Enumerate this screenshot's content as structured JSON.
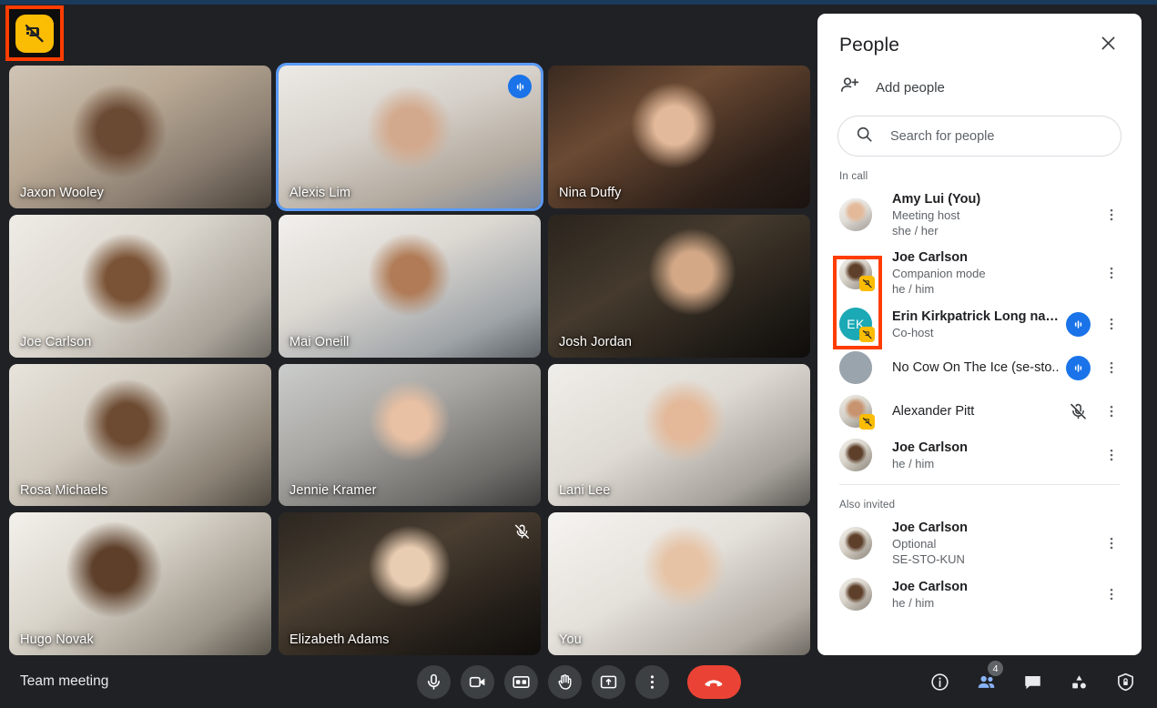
{
  "companion_toggle": {
    "name": "companion-mode-off-button",
    "icon": "screen-share-off-icon",
    "color": "#fbbc04",
    "highlight_color": "#ff3d00"
  },
  "grid": {
    "tiles": [
      {
        "name": "Jaxon Wooley",
        "speaking": false,
        "muted": false,
        "style": "p1"
      },
      {
        "name": "Alexis Lim",
        "speaking": true,
        "muted": false,
        "style": "p2"
      },
      {
        "name": "Nina Duffy",
        "speaking": false,
        "muted": false,
        "style": "p3"
      },
      {
        "name": "Joe Carlson",
        "speaking": false,
        "muted": false,
        "style": "p4"
      },
      {
        "name": "Mai Oneill",
        "speaking": false,
        "muted": false,
        "style": "p5"
      },
      {
        "name": "Josh Jordan",
        "speaking": false,
        "muted": false,
        "style": "p6"
      },
      {
        "name": "Rosa Michaels",
        "speaking": false,
        "muted": false,
        "style": "p7"
      },
      {
        "name": "Jennie Kramer",
        "speaking": false,
        "muted": false,
        "style": "p8"
      },
      {
        "name": "Lani Lee",
        "speaking": false,
        "muted": false,
        "style": "p9"
      },
      {
        "name": "Hugo Novak",
        "speaking": false,
        "muted": false,
        "style": "p10"
      },
      {
        "name": "Elizabeth Adams",
        "speaking": false,
        "muted": true,
        "style": "p11"
      },
      {
        "name": "You",
        "speaking": false,
        "muted": false,
        "style": "p12"
      }
    ]
  },
  "panel": {
    "title": "People",
    "close_icon": "close-icon",
    "add_people": {
      "label": "Add people",
      "icon": "person-add-icon"
    },
    "search": {
      "placeholder": "Search for people",
      "value": "",
      "icon": "search-icon"
    },
    "sections": [
      {
        "label": "In call",
        "people": [
          {
            "name": "Amy Lui (You)",
            "meta1": "Meeting host",
            "meta2": "she / her",
            "avatar_style": "a-amy",
            "avatar_type": "photo",
            "initials": "",
            "companion_badge": false,
            "audio_badge": false,
            "muted_icon": false
          },
          {
            "name": "Joe Carlson",
            "meta1": "Companion mode",
            "meta2": "he / him",
            "avatar_style": "a-joe",
            "avatar_type": "photo",
            "initials": "",
            "companion_badge": true,
            "audio_badge": false,
            "muted_icon": false
          },
          {
            "name": "Erin Kirkpatrick Long nam...",
            "meta1": "Co-host",
            "meta2": "",
            "avatar_style": "",
            "avatar_type": "initials",
            "initials": "EK",
            "initials_color": "#1aa9b5",
            "companion_badge": true,
            "audio_badge": true,
            "muted_icon": false
          },
          {
            "name": "No Cow On The Ice (se-sto..",
            "meta1": "",
            "meta2": "",
            "avatar_style": "a-blank",
            "avatar_type": "photo",
            "initials": "",
            "companion_badge": false,
            "audio_badge": true,
            "muted_icon": false
          },
          {
            "name": "Alexander Pitt",
            "meta1": "",
            "meta2": "",
            "avatar_style": "a-alex",
            "avatar_type": "photo",
            "initials": "",
            "companion_badge": true,
            "audio_badge": false,
            "muted_icon": true
          },
          {
            "name": "Joe Carlson",
            "meta1": "he / him",
            "meta2": "",
            "avatar_style": "a-joe",
            "avatar_type": "photo",
            "initials": "",
            "companion_badge": false,
            "audio_badge": false,
            "muted_icon": false
          }
        ]
      },
      {
        "label": "Also invited",
        "people": [
          {
            "name": "Joe Carlson",
            "meta1": "Optional",
            "meta2": "SE-STO-KUN",
            "avatar_style": "a-joe",
            "avatar_type": "photo",
            "initials": "",
            "companion_badge": false,
            "audio_badge": false,
            "muted_icon": false
          },
          {
            "name": "Joe Carlson",
            "meta1": "he / him",
            "meta2": "",
            "avatar_style": "a-joe",
            "avatar_type": "photo",
            "initials": "",
            "companion_badge": false,
            "audio_badge": false,
            "muted_icon": false
          }
        ]
      }
    ]
  },
  "bottombar": {
    "meeting_title": "Team meeting",
    "controls": [
      {
        "name": "microphone-button",
        "icon": "mic-icon",
        "kind": "normal"
      },
      {
        "name": "camera-button",
        "icon": "video-camera-icon",
        "kind": "normal"
      },
      {
        "name": "captions-button",
        "icon": "closed-caption-icon",
        "kind": "normal"
      },
      {
        "name": "raise-hand-button",
        "icon": "hand-icon",
        "kind": "normal"
      },
      {
        "name": "present-now-button",
        "icon": "present-screen-icon",
        "kind": "normal"
      },
      {
        "name": "more-options-button",
        "icon": "more-vertical-icon",
        "kind": "normal"
      },
      {
        "name": "leave-call-button",
        "icon": "end-call-icon",
        "kind": "leave"
      }
    ],
    "right_controls": [
      {
        "name": "meeting-details-button",
        "icon": "info-icon",
        "badge": "",
        "active": false
      },
      {
        "name": "people-panel-button",
        "icon": "people-icon",
        "badge": "4",
        "active": true
      },
      {
        "name": "chat-panel-button",
        "icon": "chat-icon",
        "badge": "",
        "active": false
      },
      {
        "name": "activities-button",
        "icon": "shapes-icon",
        "badge": "",
        "active": false
      },
      {
        "name": "host-controls-button",
        "icon": "shield-lock-icon",
        "badge": "",
        "active": false
      }
    ]
  }
}
